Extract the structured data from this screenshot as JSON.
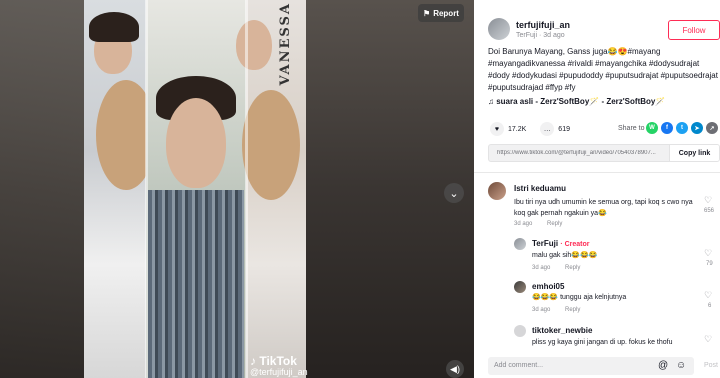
{
  "video": {
    "report_label": "Report",
    "watermark_logo": "TikTok",
    "watermark_user": "@terfujifuji_an",
    "banner_text": "VANESSA"
  },
  "author": {
    "username": "terfujifuji_an",
    "nickname": "TerFuji",
    "age": "· 3d ago",
    "follow_label": "Follow"
  },
  "caption": "Doi Barunya Mayang, Ganss juga😂😍#mayang #mayangadikvanessa #rivaldi #mayangchika #dodysudrajat #dody #dodykudasi #pupudoddy #puputsudrajat #puputsoedrajat #puputsudrajad #ffyp #fy",
  "music": "♫  suara asli - Zerz'SoftBoy🪄 - Zerz'SoftBoy🪄",
  "stats": {
    "likes": "17.2K",
    "comments": "619"
  },
  "share": {
    "label": "Share to",
    "icons": [
      "whatsapp-icon",
      "facebook-icon",
      "twitter-icon",
      "telegram-icon",
      "more-share-icon"
    ]
  },
  "link": {
    "url": "https://www.tiktok.com/@terfujifuji_an/video/70540378907...",
    "copy_label": "Copy link"
  },
  "comments": [
    {
      "name": "Istri keduamu",
      "text": "Ibu tiri nya udh umumin ke semua org, tapi koq s cwo nya koq gak pernah ngakuin ya😂",
      "time": "3d ago",
      "reply": "Reply",
      "likes": "656"
    },
    {
      "name": "TerFuji",
      "badge": "· Creator",
      "text": "malu gak sih😂😂😂",
      "time": "3d ago",
      "reply": "Reply",
      "likes": "79"
    },
    {
      "name": "emhoi05",
      "text": "😂😂😂 tunggu aja kelnjutnya",
      "time": "3d ago",
      "reply": "Reply",
      "likes": "6"
    },
    {
      "name": "tiktoker_newbie",
      "text": "pliss yg kaya gini jangan di up. fokus ke thofu",
      "time": "",
      "reply": "",
      "likes": ""
    }
  ],
  "add_comment": {
    "placeholder": "Add comment...",
    "post_label": "Post"
  },
  "colors": {
    "accent": "#fe2c55",
    "text": "#161823"
  }
}
